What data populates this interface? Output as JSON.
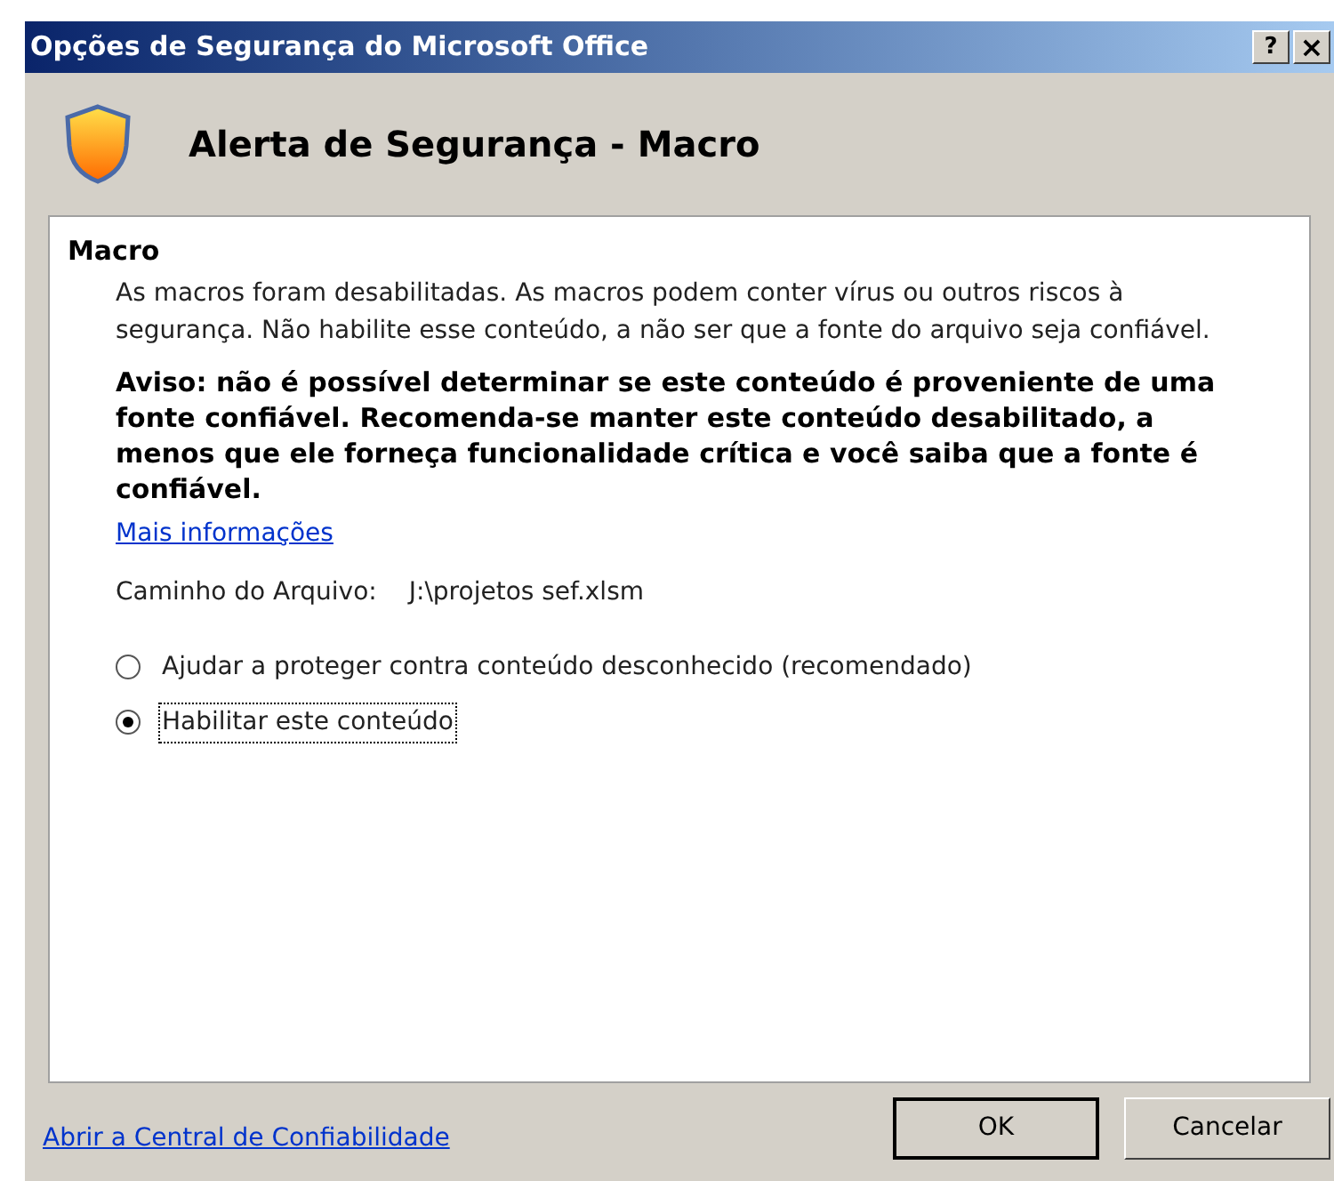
{
  "window": {
    "title": "Opções de Segurança do Microsoft Office",
    "help_button": "?",
    "close_button": "×"
  },
  "header": {
    "title": "Alerta de Segurança - Macro"
  },
  "panel": {
    "heading": "Macro",
    "description": "As macros foram desabilitadas. As macros podem conter vírus ou outros riscos à segurança. Não habilite esse conteúdo, a não ser que a fonte do arquivo seja confiável.",
    "warning": "Aviso: não é possível determinar se este conteúdo é proveniente de uma fonte confiável. Recomenda-se manter este conteúdo desabilitado, a menos que ele forneça funcionalidade crítica e você saiba que a fonte é confiável.",
    "more_info_link": "Mais informações",
    "file_path_label": "Caminho do Arquivo:",
    "file_path": "J:\\projetos sef.xlsm",
    "options": [
      {
        "label": "Ajudar a proteger contra conteúdo desconhecido (recomendado)",
        "selected": false
      },
      {
        "label": "Habilitar este conteúdo",
        "selected": true
      }
    ]
  },
  "footer": {
    "trust_center_link": "Abrir a Central de Confiabilidade",
    "buttons": [
      {
        "label": "OK",
        "default": true
      },
      {
        "label": "Cancelar",
        "default": false
      }
    ]
  }
}
